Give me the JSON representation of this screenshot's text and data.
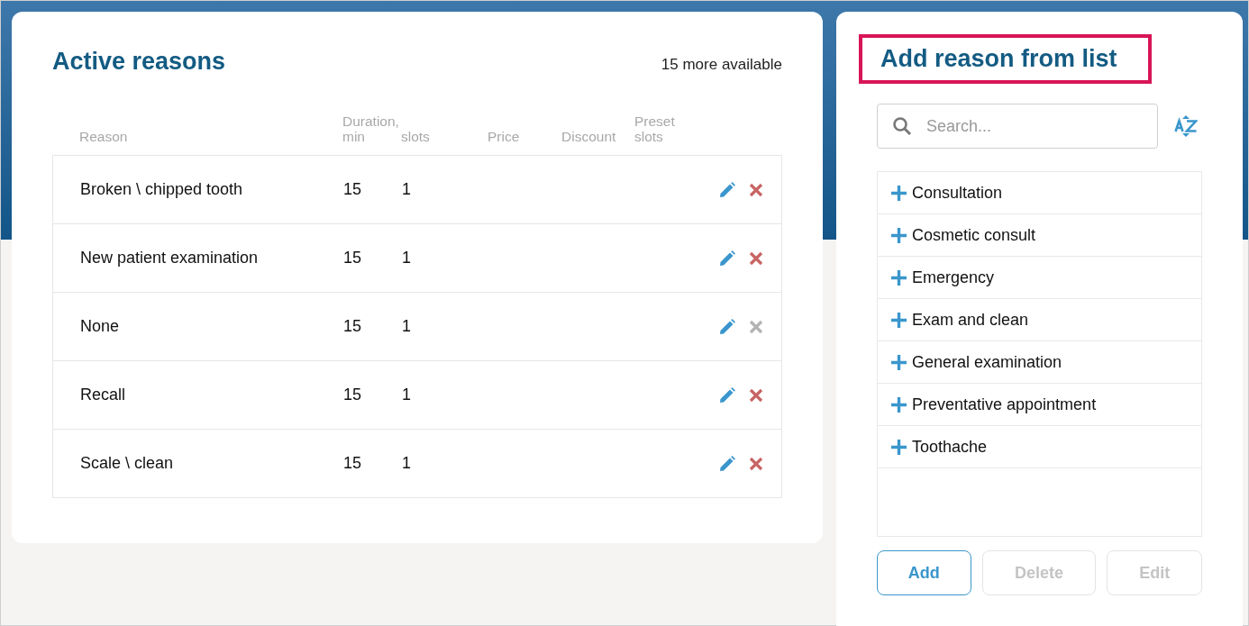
{
  "active_reasons": {
    "title": "Active reasons",
    "more_available": "15 more available",
    "columns": [
      "Reason",
      "Duration,\nmin",
      "slots",
      "Price",
      "Discount",
      "Preset\nslots"
    ],
    "rows": [
      {
        "reason": "Broken \\ chipped tooth",
        "duration": "15",
        "slots": "1",
        "delete_disabled": false
      },
      {
        "reason": "New patient examination",
        "duration": "15",
        "slots": "1",
        "delete_disabled": false
      },
      {
        "reason": "None",
        "duration": "15",
        "slots": "1",
        "delete_disabled": true
      },
      {
        "reason": "Recall",
        "duration": "15",
        "slots": "1",
        "delete_disabled": false
      },
      {
        "reason": "Scale \\ clean",
        "duration": "15",
        "slots": "1",
        "delete_disabled": false
      }
    ]
  },
  "reason_list": {
    "title": "Add reason from list",
    "title_highlighted": true,
    "search": {
      "placeholder": "Search..."
    },
    "items": [
      "Consultation",
      "Cosmetic consult",
      "Emergency",
      "Exam and clean",
      "General examination",
      "Preventative appointment",
      "Toothache"
    ],
    "buttons": [
      {
        "label": "Add",
        "disabled": false
      },
      {
        "label": "Delete",
        "disabled": true
      },
      {
        "label": "Edit",
        "disabled": true
      }
    ]
  }
}
